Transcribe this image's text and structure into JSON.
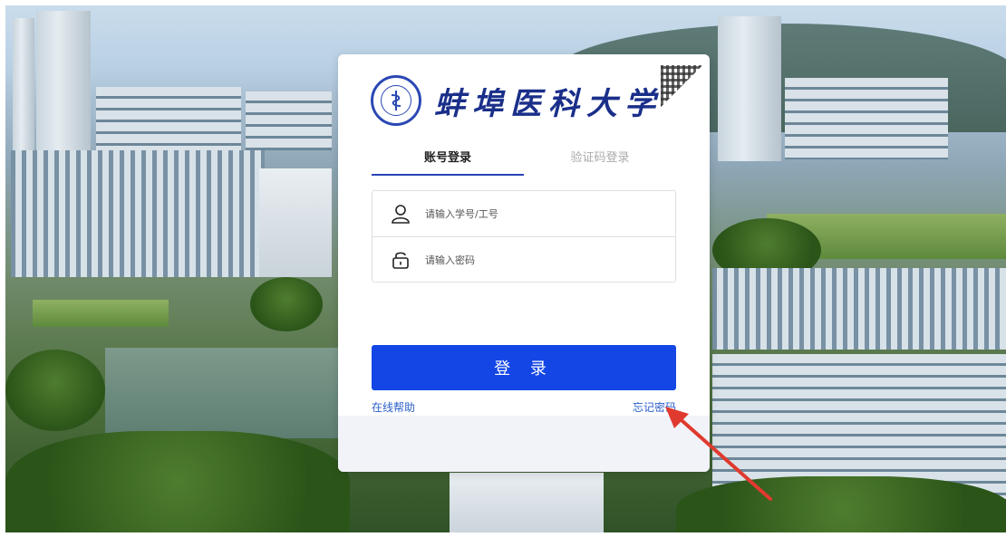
{
  "school": {
    "name": "蚌埠医科大学"
  },
  "tabs": [
    {
      "label": "账号登录",
      "active": true
    },
    {
      "label": "验证码登录",
      "active": false
    }
  ],
  "form": {
    "username_placeholder": "请输入学号/工号",
    "username_icon": "user-icon",
    "password_placeholder": "请输入密码",
    "password_icon": "lock-icon"
  },
  "login_button": {
    "label": "登 录",
    "color": "#1446e6"
  },
  "links": {
    "help": "在线帮助",
    "forgot_password": "忘记密码"
  },
  "colors": {
    "accent": "#1446e6",
    "tab_underline": "#2745b5",
    "link": "#2a5fc9",
    "annotation_arrow": "#e03a2f"
  }
}
